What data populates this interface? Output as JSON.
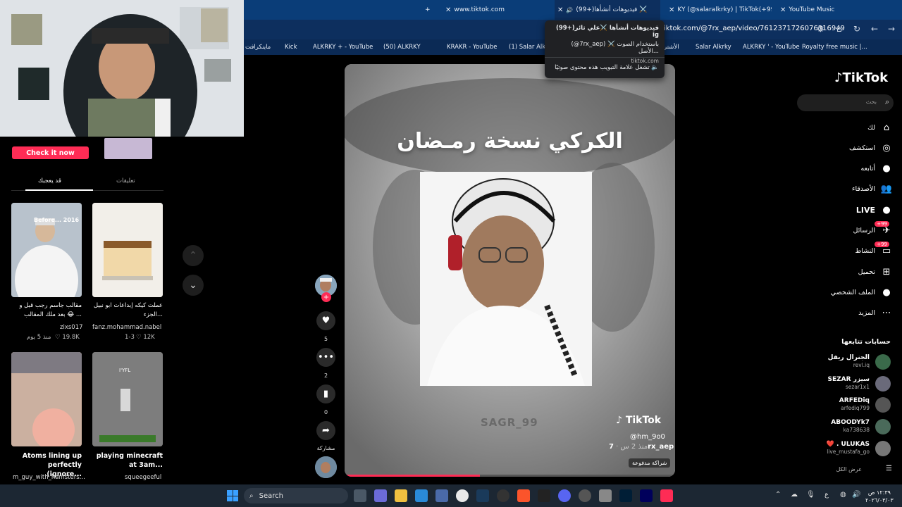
{
  "browser": {
    "tabs": [
      {
        "title": "www.tiktok.com"
      },
      {
        "title": "(99+)فيديوهات أنشأها ⚔️"
      },
      {
        "title": "KY (@salaralkrky) | TikTok(+99)"
      },
      {
        "title": "YouTube Music"
      }
    ],
    "new_tab": "+",
    "url": "tiktok.com/@7rx_aep/video/7612371726076316949",
    "bookmarks": [
      "Royalty free music |...",
      "ALKRKY ' - YouTube",
      "Salar Alkrky",
      "الأشتر",
      "(1) Salar Alkrky",
      "KRAKR - YouTube",
      "(50) ALKRKY",
      "ALKRKY + - YouTube",
      "Kick",
      "ماينكرافت"
    ]
  },
  "tooltip": {
    "line1": "(99+)فيديوهات أنشأها ⚔️علي ثائر ig",
    "line2": "(@7rx_aep) ⚔️ باستخدام الصوت الأصل...",
    "domain": "tiktok.com",
    "audio_note": "تشغل علامة التبويب هذه محتوى صوتيًا"
  },
  "left": {
    "check_button": "Check it now",
    "tabs": [
      "قد يعجبك",
      "تعليقات"
    ],
    "cards": [
      {
        "title": "مقالب جاسم رجب قبل و بعد ملك المقالب 😂 ...",
        "author": "zixs017",
        "likes": "19.8K",
        "time": "منذ 5 يوم",
        "thumb_text": "Before... 2016"
      },
      {
        "title": "عملت كيكه إبداعات ابو نبيل الجزء...",
        "author": "fanz.mohammad.nabel",
        "likes": "12K",
        "time": "1-3",
        "thumb_text": ""
      },
      {
        "title": "Atoms lining up perfectly (ignore...",
        "author": "m_guy_with_hamsters...",
        "likes": "",
        "time": "",
        "thumb_text": ""
      },
      {
        "title": "playing minecraft at 3am...",
        "author": "squeegeeful",
        "likes": "",
        "time": "",
        "thumb_text": "I'YFL"
      }
    ]
  },
  "video": {
    "title": "الكركي نسخة رمـضان",
    "watermark": "SAGR_99",
    "tiktok_logo": "TikTok",
    "tt_user": "@hm_9o0",
    "author": "7rx_aep",
    "time_ago": "منذ 2 س ·",
    "paid": "شراكة مدفوعة",
    "progress": 0.41
  },
  "rail": {
    "likes": "5",
    "comments": "2",
    "saves": "0",
    "share_label": "مشاركة"
  },
  "sidebar": {
    "brand": "TikTok",
    "search_placeholder": "بحث",
    "nav": [
      {
        "label": "لك",
        "icon": "home-icon"
      },
      {
        "label": "استكشف",
        "icon": "compass-icon"
      },
      {
        "label": "أتابعه",
        "icon": "following-icon"
      },
      {
        "label": "الأصدقاء",
        "icon": "friends-icon"
      },
      {
        "label": "LIVE",
        "icon": "live-icon"
      },
      {
        "label": "الرسائل",
        "icon": "messages-icon",
        "badge": "+99"
      },
      {
        "label": "النشاط",
        "icon": "activity-icon",
        "badge": "+99"
      },
      {
        "label": "تحميل",
        "icon": "upload-icon"
      },
      {
        "label": "الملف الشخصي",
        "icon": "profile-icon"
      },
      {
        "label": "المزيد",
        "icon": "more-icon"
      }
    ],
    "following_title": "حسابات تتابعها",
    "following": [
      {
        "name": "الجنرال ريفل",
        "handle": "revl.iq"
      },
      {
        "name": "SEZAR سيزر",
        "handle": "sezar1x1"
      },
      {
        "name": "ARFEDiq",
        "handle": "arfediq799"
      },
      {
        "name": "ABOODYk7",
        "handle": "ka738638"
      },
      {
        "name": "❤️ . ULUKAS",
        "handle": "live_mustafa_go"
      }
    ],
    "see_all": "عرض الكل"
  },
  "taskbar": {
    "search": "Search",
    "time": "١٢:٣٩ ص",
    "date": "٢٠٢٦/٠٣/٠٣"
  }
}
